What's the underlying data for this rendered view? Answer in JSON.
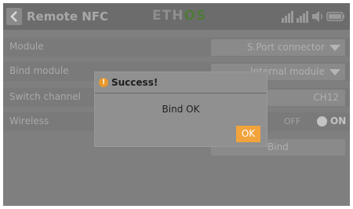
{
  "header": {
    "title": "Remote NFC",
    "logo_prefix": "ETH",
    "logo_suffix": "OS",
    "back_icon": "chevron-left-icon",
    "status_icons": [
      "signal-icon",
      "signal-icon",
      "volume-icon",
      "battery-icon"
    ]
  },
  "settings": {
    "module": {
      "label": "Module",
      "value": "S.Port connector"
    },
    "bind_module": {
      "label": "Bind module",
      "value": "Internal module"
    },
    "switch_channel": {
      "label": "Switch channel",
      "value": "CH12"
    },
    "wireless": {
      "label": "Wireless",
      "off_label": "OFF",
      "on_label": "ON"
    },
    "bind_button": "Bind"
  },
  "dialog": {
    "title": "Success!",
    "message": "Bind OK",
    "ok_label": "OK",
    "icon": "warning-icon",
    "accent_color": "#f2a33b"
  }
}
